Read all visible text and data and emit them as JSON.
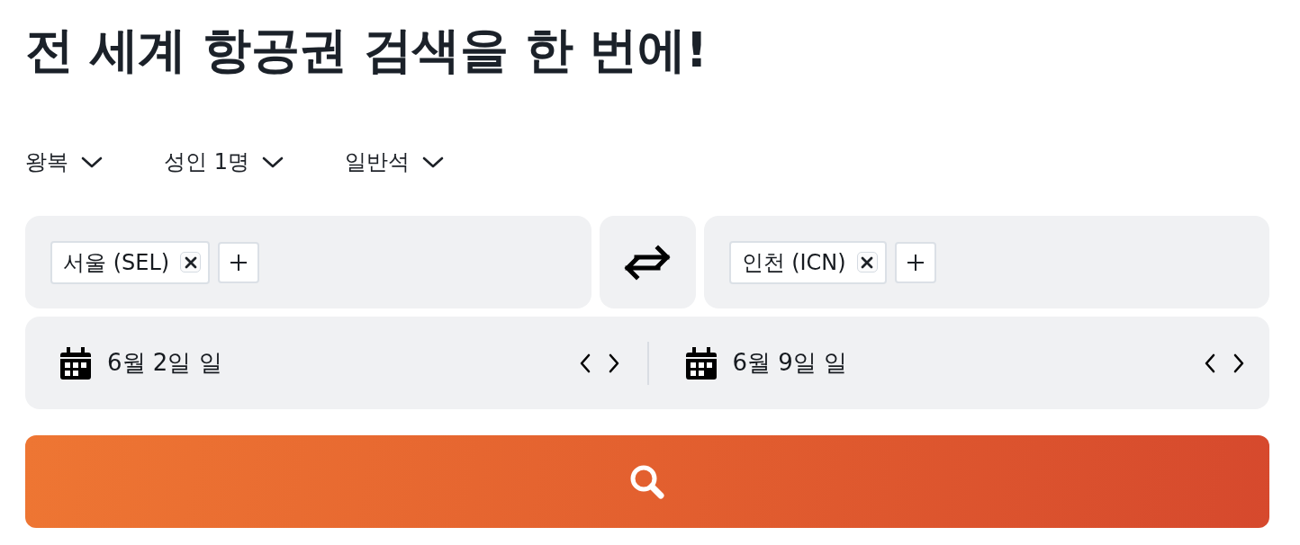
{
  "heading": "전 세계 항공권 검색을 한 번에!",
  "options": [
    {
      "label": "왕복"
    },
    {
      "label": "성인 1명"
    },
    {
      "label": "일반석"
    }
  ],
  "route": {
    "origin": {
      "chips": [
        {
          "label": "서울 (SEL)"
        }
      ]
    },
    "destination": {
      "chips": [
        {
          "label": "인천 (ICN)"
        }
      ]
    }
  },
  "dates": [
    {
      "label": "6월 2일 일"
    },
    {
      "label": "6월 9일 일"
    }
  ]
}
